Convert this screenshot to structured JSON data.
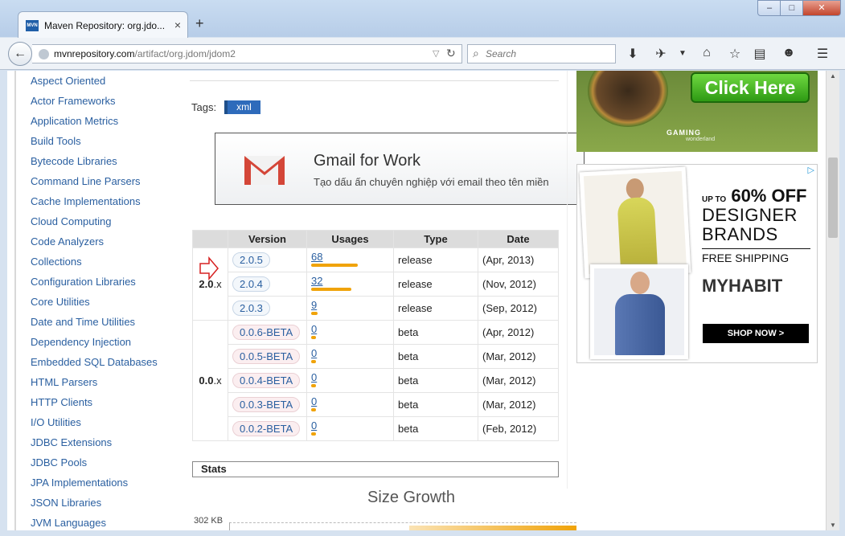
{
  "browser": {
    "tab_title": "Maven Repository: org.jdo...",
    "tab_favicon_text": "MVN",
    "url_domain": "mvnrepository.com",
    "url_path": "/artifact/org.jdom/jdom2",
    "search_placeholder": "Search"
  },
  "sidebar": {
    "categories": [
      "Aspect Oriented",
      "Actor Frameworks",
      "Application Metrics",
      "Build Tools",
      "Bytecode Libraries",
      "Command Line Parsers",
      "Cache Implementations",
      "Cloud Computing",
      "Code Analyzers",
      "Collections",
      "Configuration Libraries",
      "Core Utilities",
      "Date and Time Utilities",
      "Dependency Injection",
      "Embedded SQL Databases",
      "HTML Parsers",
      "HTTP Clients",
      "I/O Utilities",
      "JDBC Extensions",
      "JDBC Pools",
      "JPA Implementations",
      "JSON Libraries",
      "JVM Languages"
    ]
  },
  "main": {
    "tags_label": "Tags:",
    "tags": [
      "xml"
    ],
    "versions_table": {
      "headers": [
        "Version",
        "Usages",
        "Type",
        "Date"
      ],
      "groups": [
        {
          "label": "2.0",
          "suffix": ".x",
          "rows": [
            {
              "version": "2.0.5",
              "usages": "68",
              "usage_fraction": 1.0,
              "type": "release",
              "date": "(Apr, 2013)"
            },
            {
              "version": "2.0.4",
              "usages": "32",
              "usage_fraction": 0.87,
              "type": "release",
              "date": "(Nov, 2012)"
            },
            {
              "version": "2.0.3",
              "usages": "9",
              "usage_fraction": 0.14,
              "type": "release",
              "date": "(Sep, 2012)"
            }
          ]
        },
        {
          "label": "0.0",
          "suffix": ".x",
          "rows": [
            {
              "version": "0.0.6-BETA",
              "usages": "0",
              "usage_fraction": 0.1,
              "type": "beta",
              "date": "(Apr, 2012)"
            },
            {
              "version": "0.0.5-BETA",
              "usages": "0",
              "usage_fraction": 0.1,
              "type": "beta",
              "date": "(Mar, 2012)"
            },
            {
              "version": "0.0.4-BETA",
              "usages": "0",
              "usage_fraction": 0.1,
              "type": "beta",
              "date": "(Mar, 2012)"
            },
            {
              "version": "0.0.3-BETA",
              "usages": "0",
              "usage_fraction": 0.1,
              "type": "beta",
              "date": "(Mar, 2012)"
            },
            {
              "version": "0.0.2-BETA",
              "usages": "0",
              "usage_fraction": 0.1,
              "type": "beta",
              "date": "(Feb, 2012)"
            }
          ]
        }
      ]
    },
    "stats_label": "Stats",
    "size_growth_title": "Size Growth",
    "size_growth_y_label": "302 KB"
  },
  "ads": {
    "gmail": {
      "title": "Gmail for Work",
      "subtitle": "Tạo dấu ấn chuyên nghiệp với email theo tên miền"
    },
    "game": {
      "cta": "Click Here",
      "brand": "GAMING",
      "brand2": "wonderland"
    },
    "fashion": {
      "line1_prefix": "UP TO",
      "line1": "60% OFF",
      "line2": "DESIGNER",
      "line3": "BRANDS",
      "line4": "FREE SHIPPING",
      "line5": "MYHABIT",
      "cta": "SHOP NOW >"
    }
  },
  "colors": {
    "link": "#2a5fa0",
    "tag_bg": "#2e6bbb",
    "usage_bar": "#f0a30a"
  }
}
